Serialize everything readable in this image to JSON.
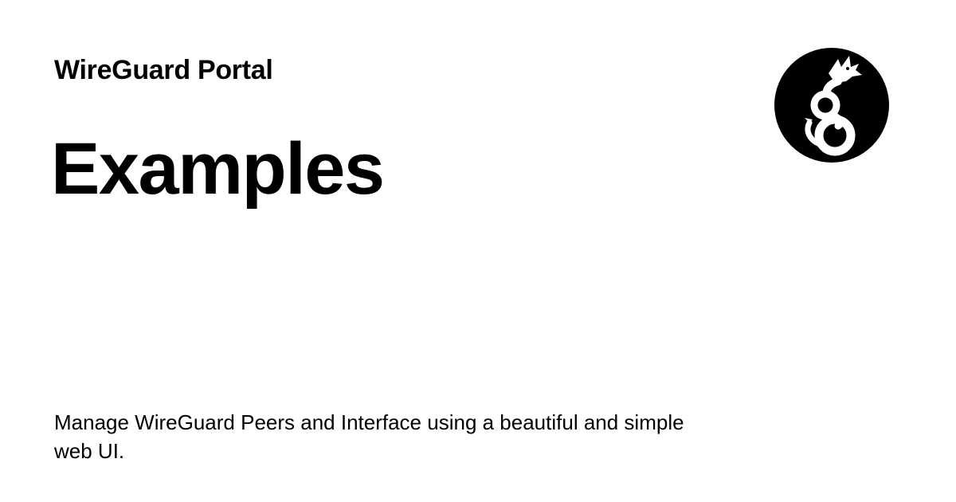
{
  "header": {
    "site_name": "WireGuard Portal"
  },
  "main": {
    "title": "Examples",
    "description": "Manage WireGuard Peers and Interface using a beautiful and simple web UI."
  },
  "logo": {
    "icon": "wireguard-dragon-icon",
    "background_color": "#000000",
    "foreground_color": "#ffffff"
  }
}
